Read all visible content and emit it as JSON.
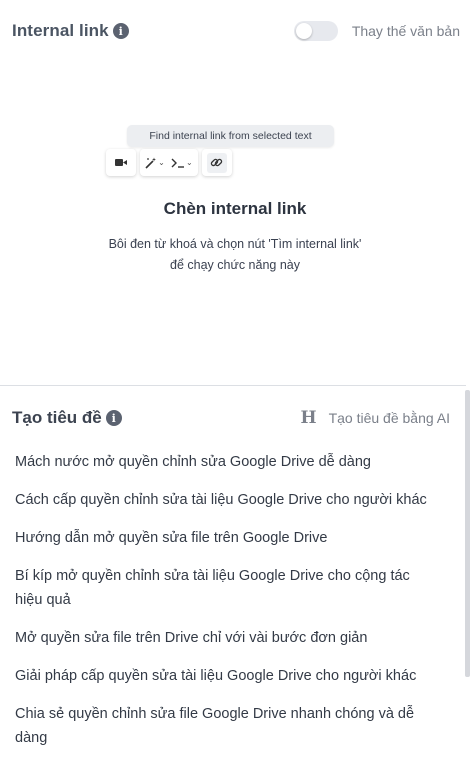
{
  "internal_link": {
    "title": "Internal link",
    "info_icon": "i",
    "toggle_label": "Thay thế văn bản",
    "toggle_on": false,
    "tooltip": "Find internal link from selected text",
    "empty_title": "Chèn internal link",
    "empty_desc": "Bôi đen từ khoá và chọn nút 'Tìm internal link' để chạy chức năng này",
    "toolbar_icons": [
      "video-icon",
      "magic-wand-icon",
      "terminal-icon",
      "link-icon"
    ]
  },
  "title_generator": {
    "title": "Tạo tiêu đề",
    "info_icon": "i",
    "ai_icon": "H",
    "ai_label": "Tạo tiêu đề bằng AI",
    "suggestions": [
      "Mách nước mở quyền chỉnh sửa Google Drive dễ dàng",
      "Cách cấp quyền chỉnh sửa tài liệu Google Drive cho người khác",
      "Hướng dẫn mở quyền sửa file trên Google Drive",
      "Bí kíp mở quyền chỉnh sửa tài liệu Google Drive cho cộng tác hiệu quả",
      "Mở quyền sửa file trên Drive chỉ với vài bước đơn giản",
      "Giải pháp cấp quyền sửa tài liệu Google Drive cho người khác",
      "Chia sẻ quyền chỉnh sửa file Google Drive nhanh chóng và dễ dàng"
    ]
  },
  "colors": {
    "text": "#2b3340",
    "muted": "#7b808a",
    "toggle_off": "#e7e9ee"
  }
}
